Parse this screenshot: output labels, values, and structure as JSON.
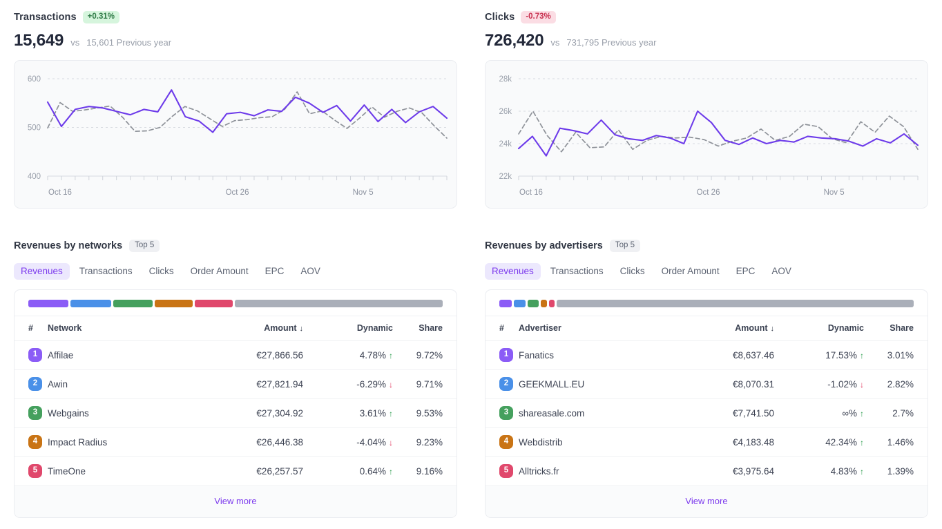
{
  "colors": {
    "accent": "#7c3aed",
    "line_current": "#6d3bea",
    "line_previous": "#8e9299",
    "positive": "#2f9e51",
    "negative": "#e0395f",
    "rank": [
      "#8b5cf6",
      "#4a90e8",
      "#45a05e",
      "#c97415",
      "#e0486c"
    ],
    "rest": "#aaafb9"
  },
  "panels": {
    "transactions": {
      "title": "Transactions",
      "delta": "+0.31%",
      "delta_dir": "up",
      "value": "15,649",
      "vs": "vs",
      "previous": "15,601 Previous year"
    },
    "clicks": {
      "title": "Clicks",
      "delta": "-0.73%",
      "delta_dir": "down",
      "value": "726,420",
      "vs": "vs",
      "previous": "731,795 Previous year"
    }
  },
  "chart_data": [
    {
      "type": "line",
      "title": "Transactions",
      "xlabel": "",
      "ylabel": "",
      "ylim": [
        400,
        600
      ],
      "yticks": [
        400,
        500,
        600
      ],
      "ytick_labels": [
        "400",
        "500",
        "600"
      ],
      "grid": true,
      "legend": "none",
      "xtick_labels": [
        "Oct 16",
        "Oct 26",
        "Nov 5"
      ],
      "xtick_index": [
        0,
        10,
        20
      ],
      "series": [
        {
          "name": "Current",
          "style": "solid",
          "color": "#6d3bea",
          "values": [
            552,
            502,
            537,
            543,
            540,
            533,
            526,
            537,
            532,
            577,
            522,
            513,
            490,
            528,
            531,
            524,
            536,
            533,
            562,
            550,
            531,
            545,
            513,
            546,
            512,
            537,
            510,
            532,
            543,
            519
          ]
        },
        {
          "name": "Previous year",
          "style": "dashed",
          "color": "#8e9299",
          "values": [
            499,
            551,
            533,
            536,
            540,
            544,
            521,
            492,
            493,
            500,
            523,
            543,
            534,
            518,
            502,
            514,
            516,
            520,
            522,
            537,
            573,
            528,
            534,
            515,
            498,
            519,
            542,
            521,
            533,
            540,
            530,
            503,
            478
          ]
        }
      ]
    },
    {
      "type": "line",
      "title": "Clicks",
      "xlabel": "",
      "ylabel": "",
      "ylim": [
        22000,
        28000
      ],
      "yticks": [
        22000,
        24000,
        26000,
        28000
      ],
      "ytick_labels": [
        "22k",
        "24k",
        "26k",
        "28k"
      ],
      "grid": true,
      "legend": "none",
      "xtick_labels": [
        "Oct 16",
        "Oct 26",
        "Nov 5"
      ],
      "xtick_index": [
        0,
        10,
        20
      ],
      "series": [
        {
          "name": "Current",
          "style": "solid",
          "color": "#6d3bea",
          "values": [
            23700,
            24450,
            23250,
            24950,
            24800,
            24600,
            25450,
            24550,
            24300,
            24200,
            24500,
            24350,
            24000,
            26000,
            25300,
            24200,
            23950,
            24350,
            24000,
            24200,
            24100,
            24450,
            24350,
            24300,
            24150,
            23850,
            24300,
            24050,
            24600,
            23900
          ]
        },
        {
          "name": "Previous year",
          "style": "dashed",
          "color": "#8e9299",
          "values": [
            24600,
            26000,
            24500,
            23500,
            24700,
            23750,
            23800,
            24850,
            23650,
            24200,
            24450,
            24350,
            24400,
            24250,
            23850,
            24150,
            24350,
            24900,
            24200,
            24450,
            25200,
            25050,
            24300,
            24050,
            25350,
            24700,
            25700,
            25050,
            23650
          ]
        }
      ]
    }
  ],
  "tables": [
    {
      "heading": "Revenues by networks",
      "badge": "Top 5",
      "tabs": [
        {
          "label": "Revenues",
          "active": true
        },
        {
          "label": "Transactions",
          "active": false
        },
        {
          "label": "Clicks",
          "active": false
        },
        {
          "label": "Order Amount",
          "active": false
        },
        {
          "label": "EPC",
          "active": false
        },
        {
          "label": "AOV",
          "active": false
        }
      ],
      "share_segments": [
        9.72,
        9.71,
        9.53,
        9.23,
        9.16
      ],
      "columns": [
        "#",
        "Network",
        "Amount",
        "Dynamic",
        "Share"
      ],
      "sort_column": "Amount",
      "sort_dir": "desc",
      "rows": [
        {
          "rank": "1",
          "name": "Affilae",
          "amount": "€27,866.56",
          "dynamic": "4.78%",
          "dir": "up",
          "share": "9.72%"
        },
        {
          "rank": "2",
          "name": "Awin",
          "amount": "€27,821.94",
          "dynamic": "-6.29%",
          "dir": "down",
          "share": "9.71%"
        },
        {
          "rank": "3",
          "name": "Webgains",
          "amount": "€27,304.92",
          "dynamic": "3.61%",
          "dir": "up",
          "share": "9.53%"
        },
        {
          "rank": "4",
          "name": "Impact Radius",
          "amount": "€26,446.38",
          "dynamic": "-4.04%",
          "dir": "down",
          "share": "9.23%"
        },
        {
          "rank": "5",
          "name": "TimeOne",
          "amount": "€26,257.57",
          "dynamic": "0.64%",
          "dir": "up",
          "share": "9.16%"
        }
      ],
      "view_more": "View more"
    },
    {
      "heading": "Revenues by advertisers",
      "badge": "Top 5",
      "tabs": [
        {
          "label": "Revenues",
          "active": true
        },
        {
          "label": "Transactions",
          "active": false
        },
        {
          "label": "Clicks",
          "active": false
        },
        {
          "label": "Order Amount",
          "active": false
        },
        {
          "label": "EPC",
          "active": false
        },
        {
          "label": "AOV",
          "active": false
        }
      ],
      "share_segments": [
        3.01,
        2.82,
        2.7,
        1.46,
        1.39
      ],
      "columns": [
        "#",
        "Advertiser",
        "Amount",
        "Dynamic",
        "Share"
      ],
      "sort_column": "Amount",
      "sort_dir": "desc",
      "rows": [
        {
          "rank": "1",
          "name": "Fanatics",
          "amount": "€8,637.46",
          "dynamic": "17.53%",
          "dir": "up",
          "share": "3.01%"
        },
        {
          "rank": "2",
          "name": "GEEKMALL.EU",
          "amount": "€8,070.31",
          "dynamic": "-1.02%",
          "dir": "down",
          "share": "2.82%"
        },
        {
          "rank": "3",
          "name": "shareasale.com",
          "amount": "€7,741.50",
          "dynamic": "∞%",
          "dir": "up",
          "share": "2.7%"
        },
        {
          "rank": "4",
          "name": "Webdistrib",
          "amount": "€4,183.48",
          "dynamic": "42.34%",
          "dir": "up",
          "share": "1.46%"
        },
        {
          "rank": "5",
          "name": "Alltricks.fr",
          "amount": "€3,975.64",
          "dynamic": "4.83%",
          "dir": "up",
          "share": "1.39%"
        }
      ],
      "view_more": "View more"
    }
  ],
  "icons": {
    "arrow_up": "↑",
    "arrow_down": "↓",
    "sort_desc": "↓"
  }
}
